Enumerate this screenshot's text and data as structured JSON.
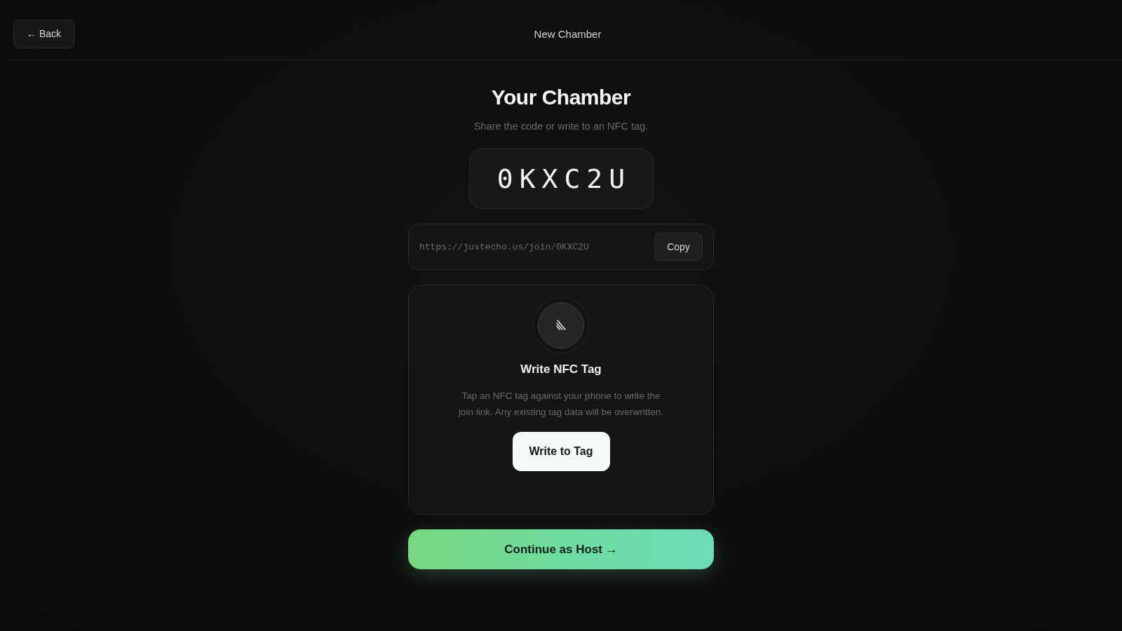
{
  "header": {
    "back_button": "← Back",
    "title": "New Chamber"
  },
  "heading": "Your Chamber",
  "subtitle": "Share the code or write to an NFC tag.",
  "room_code": "0KXC2U",
  "link": {
    "value": "https://justecho.us/join/0KXC2U",
    "copy_button": "Copy"
  },
  "nfc_card": {
    "title": "Write NFC Tag",
    "description": "Tap an NFC tag against your phone to write the join link. Any existing tag data will be overwritten.",
    "button": "Write to Tag"
  },
  "continue_button": "Continue as Host →"
}
